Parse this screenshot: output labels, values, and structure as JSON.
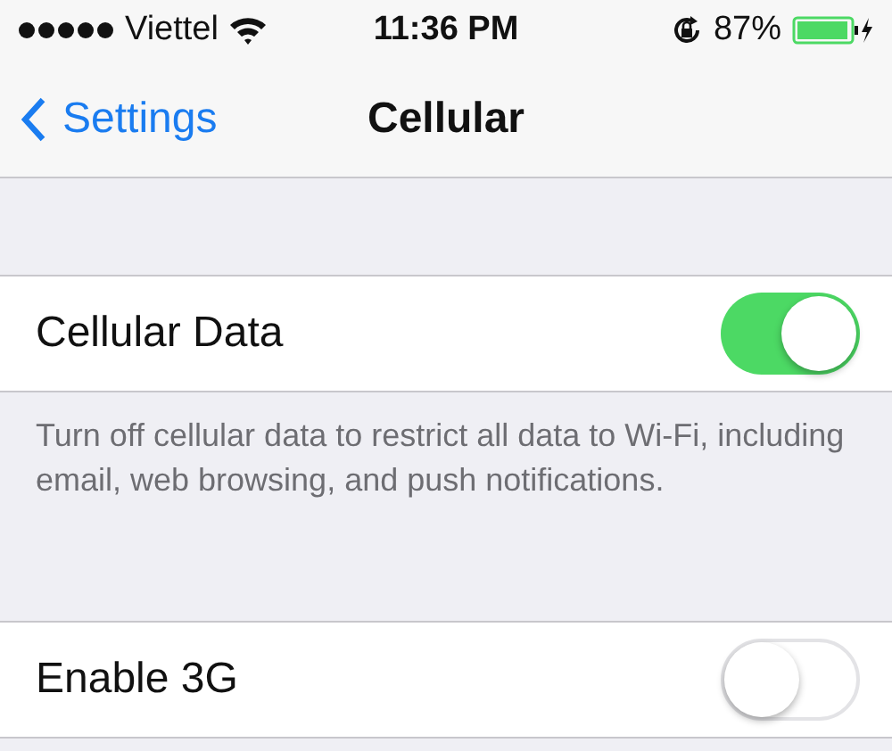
{
  "status_bar": {
    "carrier": "Viettel",
    "time": "11:36 PM",
    "battery": "87%"
  },
  "nav_bar": {
    "back": "Settings",
    "title": "Cellular"
  },
  "sections": [
    {
      "kind": "toggle",
      "label": "Cellular Data",
      "on": true,
      "footer": "Turn off cellular data to restrict all data to Wi-Fi, including email, web browsing, and push notifications."
    },
    {
      "kind": "toggle",
      "label": "Enable 3G",
      "on": false
    }
  ]
}
